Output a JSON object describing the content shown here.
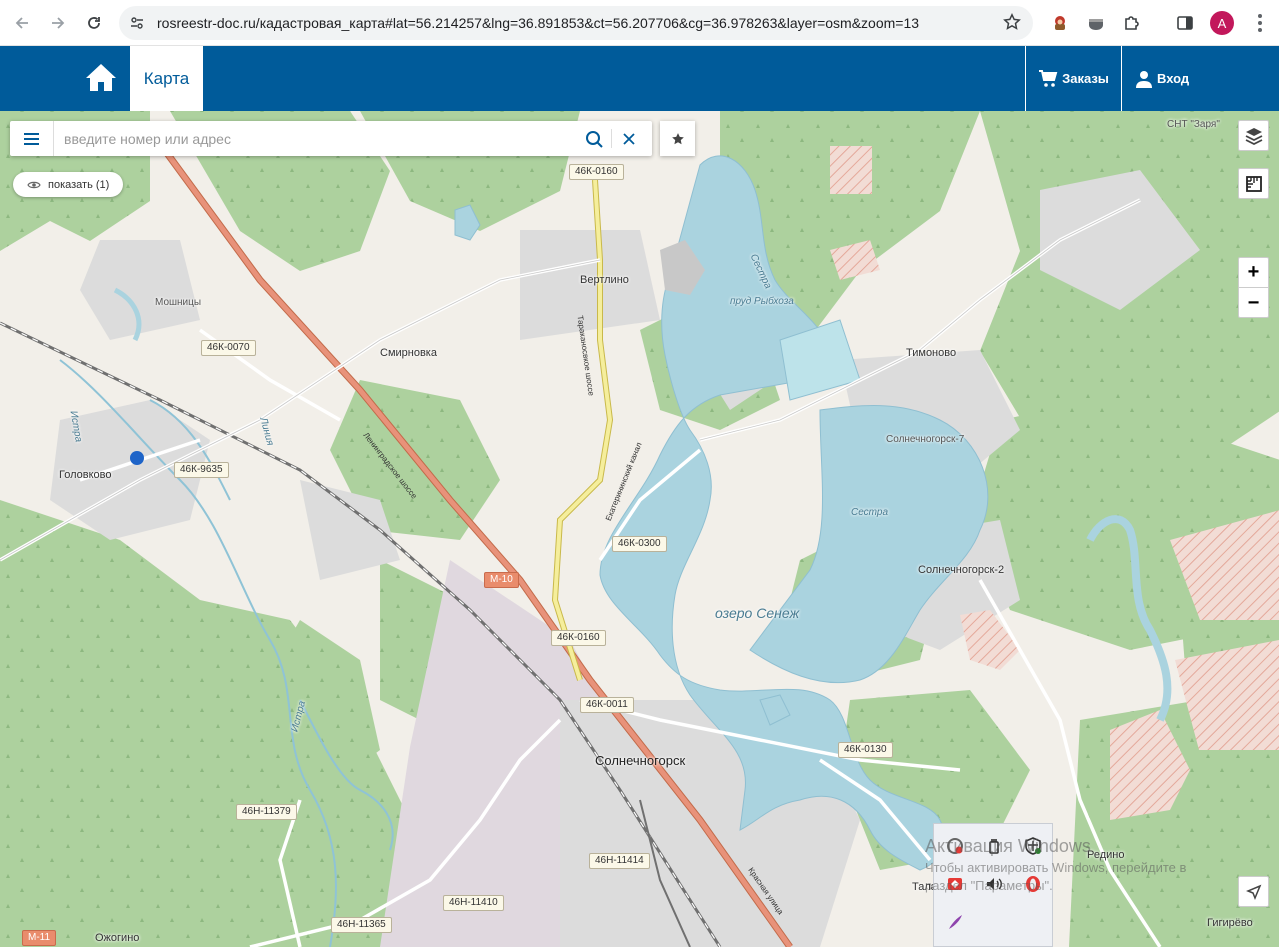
{
  "browser": {
    "url": "rosreestr-doc.ru/кадастровая_карта#lat=56.214257&lng=36.891853&ct=56.207706&cg=36.978263&layer=osm&zoom=13",
    "avatar_letter": "A",
    "accent": "#c2185b"
  },
  "header": {
    "tab_label": "Карта",
    "orders_label": "Заказы",
    "login_label": "Вход",
    "brand_color": "#005b9a"
  },
  "search": {
    "placeholder": "введите номер или адрес",
    "value": ""
  },
  "show_pill": {
    "label": "показать (1)"
  },
  "zoom": {
    "plus": "+",
    "minus": "−"
  },
  "map": {
    "places": {
      "snt_zarya": "СНТ \"Заря\"",
      "vertlino": "Вертлино",
      "prud": "пруд Рыбхоза",
      "sestra_n": "Сестра",
      "moshnitsy": "Мошницы",
      "smirnovka": "Смирновка",
      "timonovo": "Тимоново",
      "solnechnogorsk7": "Солнечногорск-7",
      "golovkovo": "Головково",
      "istra_n": "Истра",
      "sestra_lake": "Сестра",
      "solnechnogorsk2": "Солнечногорск-2",
      "ozero": "озеро Сенеж",
      "solnechnogorsk": "Солнечногорск",
      "redino": "Редино",
      "talaevo": "Талаево",
      "gigirevo": "Гигирёво",
      "ozhogino": "Ожогино",
      "istra_s": "Истра",
      "liniya": "Линия"
    },
    "roads": {
      "r1": "46К-0160",
      "r2": "46К-0070",
      "r3": "46К-9635",
      "r4": "46К-0300",
      "r5": "М-10",
      "r6": "46К-0160",
      "r7": "46К-0011",
      "r8": "46К-0130",
      "r9": "46Н-11379",
      "r10": "46Н-11414",
      "r11": "46Н-11410",
      "r12": "46Н-11365",
      "r13": "М-11"
    },
    "street_names": {
      "leningrad": "Ленинградское шоссе",
      "taraканovskoe": "Тараканосвкое шоссе",
      "kanal": "Екатерининский канал",
      "krasnaya": "Красная улица"
    }
  },
  "watermark": {
    "line1": "Активация Windows",
    "line2": "Чтобы активировать Windows, перейдите в",
    "line3": "раздел \"Параметры\"."
  }
}
